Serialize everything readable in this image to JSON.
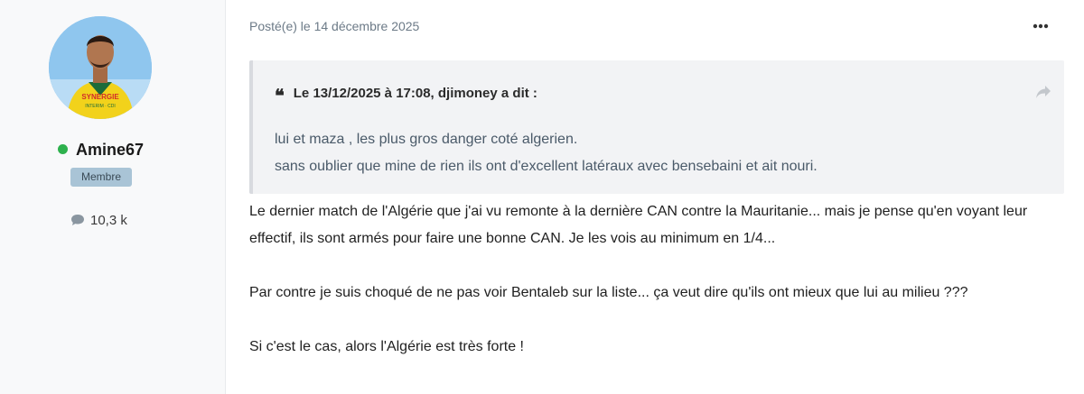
{
  "author": {
    "name": "Amine67",
    "online": true,
    "group": "Membre",
    "post_count": "10,3 k",
    "avatar_shirt_text_1": "SYNERGIE",
    "avatar_shirt_text_2": "INTERIM · CDI"
  },
  "post": {
    "date_label": "Posté(e) le 14 décembre 2025",
    "quote": {
      "citation": "Le 13/12/2025 à 17:08, djimoney a dit :",
      "lines": [
        "lui et maza , les plus gros danger coté algerien.",
        "sans oublier que mine de rien ils ont d'excellent latéraux avec bensebaini et ait nouri."
      ]
    },
    "paragraphs": [
      "Le dernier match de l'Algérie que j'ai vu remonte à la dernière CAN contre la Mauritanie... mais je pense qu'en voyant leur",
      "effectif, ils sont armés pour faire une bonne CAN. Je les vois au minimum en 1/4...",
      "Par contre je suis choqué de ne pas voir Bentaleb sur la liste... ça veut dire qu'ils ont mieux que lui au milieu ???",
      "Si c'est le cas, alors l'Algérie est très forte !"
    ]
  },
  "icons": {
    "online_status": "online-dot-icon",
    "post_count": "comment-bubble-icon",
    "menu": "ellipsis-icon",
    "quote": "quote-icon",
    "share": "share-arrow-icon"
  },
  "colors": {
    "online": "#2db14d",
    "badge_bg": "#a9c4d6",
    "quote_bg": "#f2f3f5",
    "meta_text": "#6c7a87"
  }
}
